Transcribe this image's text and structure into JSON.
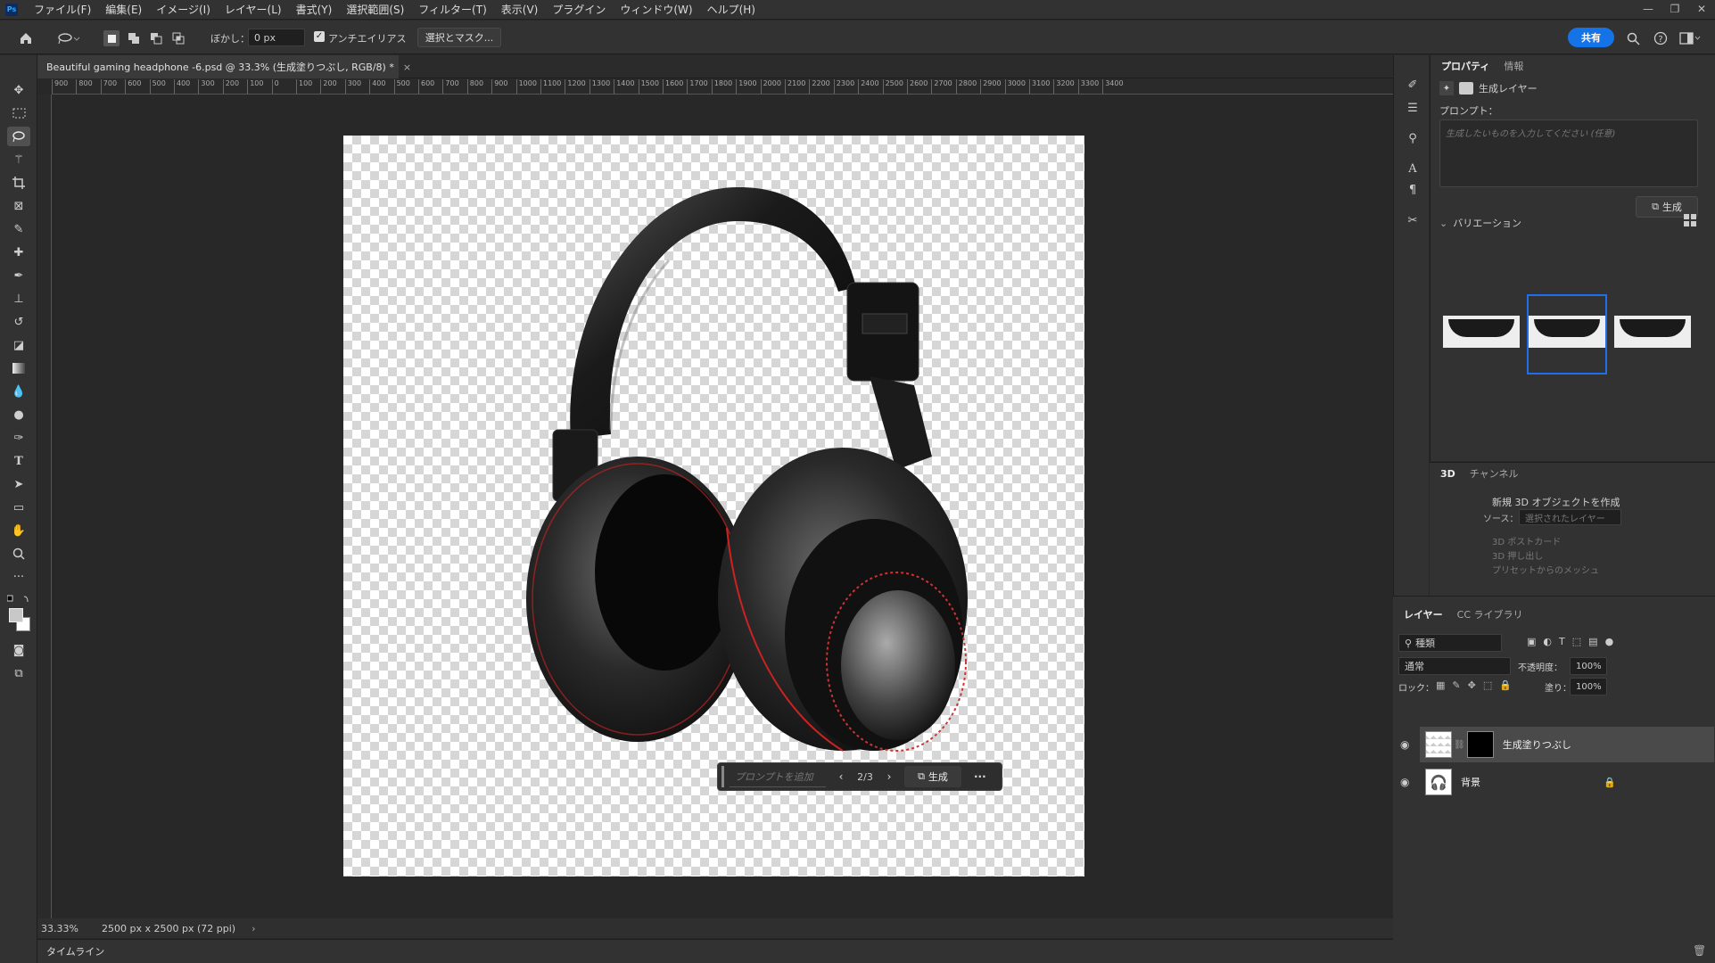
{
  "app": {
    "logo": "Ps"
  },
  "menu": [
    "ファイル(F)",
    "編集(E)",
    "イメージ(I)",
    "レイヤー(L)",
    "書式(Y)",
    "選択範囲(S)",
    "フィルター(T)",
    "表示(V)",
    "プラグイン",
    "ウィンドウ(W)",
    "ヘルプ(H)"
  ],
  "options": {
    "feather_label": "ぼかし：",
    "feather_value": "0 px",
    "antialias_label": "アンチエイリアス",
    "antialias_checked": true,
    "select_mask": "選択とマスク...",
    "share": "共有"
  },
  "document": {
    "tab_title": "Beautiful gaming headphone -6.psd @ 33.3% (生成塗りつぶし, RGB/8) *",
    "close": "×"
  },
  "ruler": {
    "ticks": [
      "900",
      "800",
      "700",
      "600",
      "500",
      "400",
      "300",
      "200",
      "100",
      "0",
      "100",
      "200",
      "300",
      "400",
      "500",
      "600",
      "700",
      "800",
      "900",
      "1000",
      "1100",
      "1200",
      "1300",
      "1400",
      "1500",
      "1600",
      "1700",
      "1800",
      "1900",
      "2000",
      "2100",
      "2200",
      "2300",
      "2400",
      "2500",
      "2600",
      "2700",
      "2800",
      "2900",
      "3000",
      "3100",
      "3200",
      "3300",
      "3400"
    ]
  },
  "context_bar": {
    "prompt_placeholder": "プロンプトを追加",
    "counter": "2/3",
    "generate": "生成",
    "more": "···"
  },
  "status": {
    "zoom": "33.33%",
    "doc_info": "2500 px x 2500 px (72 ppi)"
  },
  "timeline": {
    "label": "タイムライン"
  },
  "properties": {
    "tabs": [
      "プロパティ",
      "情報"
    ],
    "layer_type": "生成レイヤー",
    "prompt_label": "プロンプト：",
    "prompt_placeholder": "生成したいものを入力してください (任意)",
    "generate": "生成",
    "variations_label": "バリエーション",
    "selected_variation": 2
  },
  "panel3d": {
    "tabs": [
      "3D",
      "チャンネル"
    ],
    "title": "新規 3D オブジェクトを作成",
    "source_label": "ソース：",
    "source_value": "選択されたレイヤー",
    "options": [
      "3D ポストカード",
      "3D 押し出し",
      "プリセットからのメッシュ"
    ]
  },
  "layers": {
    "tabs": [
      "レイヤー",
      "CC ライブラリ"
    ],
    "filter_kind": "種類",
    "blend_mode": "通常",
    "opacity_label": "不透明度：",
    "opacity_value": "100%",
    "lock_label": "ロック：",
    "fill_label": "塗り：",
    "fill_value": "100%",
    "items": [
      {
        "name": "生成塗りつぶし",
        "selected": true
      },
      {
        "name": "背景",
        "selected": false
      }
    ]
  },
  "colors": {
    "accent": "#1473e6",
    "selection": "#1f6feb",
    "panel": "#323232"
  }
}
